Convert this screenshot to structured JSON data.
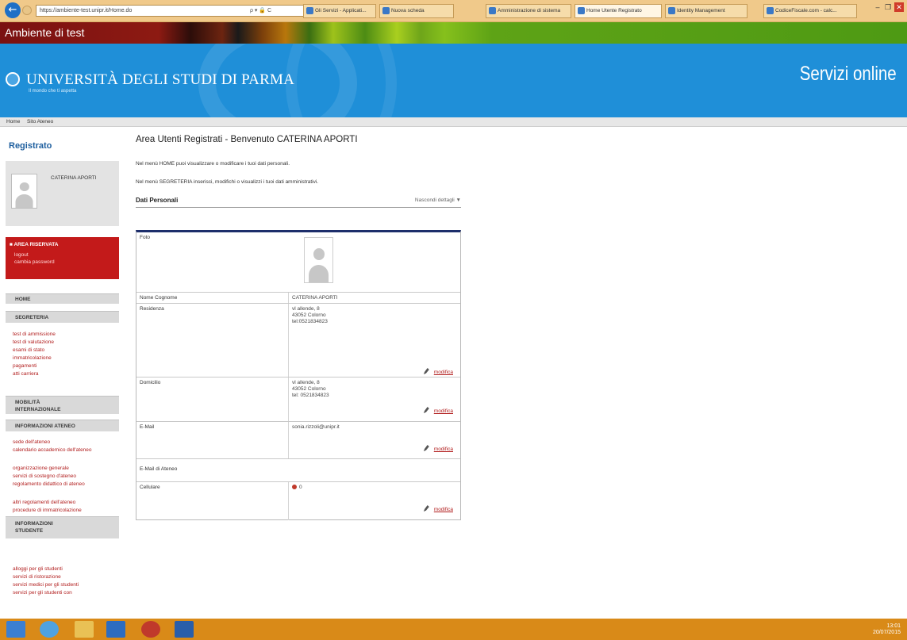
{
  "browser": {
    "address": "https://ambiente-test.unipr.it/Home.do",
    "address_tools": "ρ ▾ 🔒 C",
    "tabs": [
      {
        "label": "Gli Servizi - Applicati...",
        "active": false
      },
      {
        "label": "Nuova scheda",
        "active": false
      },
      {
        "label": "Amministrazione di sistema",
        "active": false
      },
      {
        "label": "Home Utente Registrato",
        "active": true
      },
      {
        "label": "Identity Management",
        "active": false
      },
      {
        "label": "CodiceFiscale.com - calc...",
        "active": false
      }
    ],
    "window_buttons": {
      "minimize": "–",
      "restore": "❐",
      "close": "✕"
    }
  },
  "env_banner": "Ambiente di test",
  "header": {
    "university": "UNIVERSITÀ DEGLI STUDI DI PARMA",
    "tagline": "Il mondo che ti aspetta",
    "services": "Servizi online",
    "nav": [
      "Home",
      "Sito Ateneo"
    ]
  },
  "sidebar": {
    "title": "Registrato",
    "user": "CATERINA APORTI",
    "reserved": {
      "title": "■ AREA RISERVATA",
      "links": [
        "logout",
        "cambia password"
      ]
    },
    "sections": [
      {
        "head": "HOME",
        "links": []
      },
      {
        "head": "SEGRETERIA",
        "links": [
          "test di ammissione",
          "test di valutazione",
          "esami di stato",
          "immatricolazione",
          "pagamenti",
          "atti carriera"
        ]
      },
      {
        "head": "MOBILITÀ INTERNAZIONALE",
        "links": []
      },
      {
        "head": "INFORMAZIONI ATENEO",
        "links": [
          "sede dell'ateneo",
          "calendario accademico dell'ateneo",
          "organizzazione generale",
          "servizi di sostegno d'ateneo",
          "regolamento didattico di ateneo",
          "altri regolamenti dell'ateneo",
          "procedure di immatricolazione"
        ]
      },
      {
        "head": "INFORMAZIONI STUDENTE",
        "links": [
          "alloggi per gli studenti",
          "servizi di ristorazione",
          "servizi medici per gli studenti",
          "servizi per gli studenti con"
        ]
      }
    ]
  },
  "main": {
    "welcome": "Area Utenti Registrati - Benvenuto  CATERINA APORTI",
    "intro": [
      "Nel menù HOME puoi visualizzare o modificare i tuoi dati personali.",
      "Nel menù SEGRETERIA inserisci, modifichi o visualizzi i tuoi dati amministrativi."
    ],
    "section_title": "Dati Personali",
    "section_toggle": "Nascondi dettagli ▼",
    "rows": [
      {
        "label": "Foto",
        "value": ""
      },
      {
        "label": "Nome Cognome",
        "value": "CATERINA APORTI"
      },
      {
        "label": "Residenza",
        "value": "vl allende, 8\n43052 Colorno\ntel:0521834823",
        "edit": "modifica"
      },
      {
        "label": "Domicilio",
        "value": "vl allende, 8\n43052 Colorno\ntel: 0521834823",
        "edit": "modifica"
      },
      {
        "label": "E-Mail",
        "value": "sonia.rizzoli@unipr.it",
        "edit": "modifica"
      },
      {
        "label": "E-Mail di Ateneo",
        "value": ""
      },
      {
        "label": "Cellulare",
        "value": "0",
        "edit": "modifica"
      }
    ]
  },
  "taskbar": {
    "clock": "13:01",
    "date": "20/07/2015"
  },
  "colors": {
    "header_blue": "#1f8fd8",
    "reserved_red": "#c31a1a",
    "link_red": "#b11d1d",
    "panel_top": "#1d2e6b",
    "taskbar": "#d98a18"
  }
}
